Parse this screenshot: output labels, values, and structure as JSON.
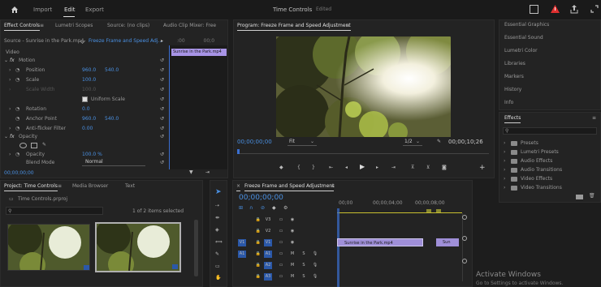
{
  "menu": {
    "home_icon": "home-icon",
    "import": "Import",
    "edit": "Edit",
    "export": "Export",
    "title": "Time Controls",
    "edited": "Edited"
  },
  "effect_controls": {
    "tabs": [
      "Effect Controls",
      "Lumetri Scopes",
      "Source: (no clips)",
      "Audio Clip Mixer: Free"
    ],
    "source": "Source - Sunrise in the Park.mp4",
    "sequence": "Freeze Frame and Speed Adj...",
    "clip_name": "Sunrise in the Park.mp4",
    "video_label": "Video",
    "motion": "Motion",
    "position": {
      "label": "Position",
      "x": "960.0",
      "y": "540.0"
    },
    "scale": {
      "label": "Scale",
      "value": "100.0"
    },
    "scale_width": {
      "label": "Scale Width",
      "value": "100.0"
    },
    "uniform_scale": "Uniform Scale",
    "rotation": {
      "label": "Rotation",
      "value": "0.0"
    },
    "anchor": {
      "label": "Anchor Point",
      "x": "960.0",
      "y": "540.0"
    },
    "anti_flicker": {
      "label": "Anti-flicker Filter",
      "value": "0.00"
    },
    "opacity": "Opacity",
    "opacity_value": {
      "label": "Opacity",
      "value": "100.0 %"
    },
    "blend": {
      "label": "Blend Mode",
      "value": "Normal"
    },
    "footer_time": "00;00;00;00"
  },
  "program": {
    "title": "Program: Freeze Frame and Speed Adjustment",
    "timecode": "00;00;00;00",
    "fit": "Fit",
    "ratio": "1/2",
    "duration": "00;00;10;26"
  },
  "right_panels": [
    "Essential Graphics",
    "Essential Sound",
    "Lumetri Color",
    "Libraries",
    "Markers",
    "History",
    "Info"
  ],
  "effects": {
    "title": "Effects",
    "items": [
      "Presets",
      "Lumetri Presets",
      "Audio Effects",
      "Audio Transitions",
      "Video Effects",
      "Video Transitions"
    ]
  },
  "project": {
    "tabs": [
      "Project: Time Controls",
      "Media Browser",
      "Text"
    ],
    "file": "Time Controls.prproj",
    "count": "1 of 2 items selected"
  },
  "timeline": {
    "title": "Freeze Frame and Speed Adjustment",
    "timecode": "00;00;00;00",
    "ruler": [
      "00;00",
      "00;00;04;00",
      "00;00;08;00"
    ],
    "tracks": [
      "V3",
      "V2",
      "V1",
      "A1",
      "A2",
      "A3"
    ],
    "src_v": "V1",
    "src_a": "A1",
    "clip1": "Sunrise in the Park.mp4",
    "clip2": "Sun"
  },
  "watermark": {
    "line1": "Activate Windows",
    "line2": "Go to Settings to activate Windows."
  }
}
